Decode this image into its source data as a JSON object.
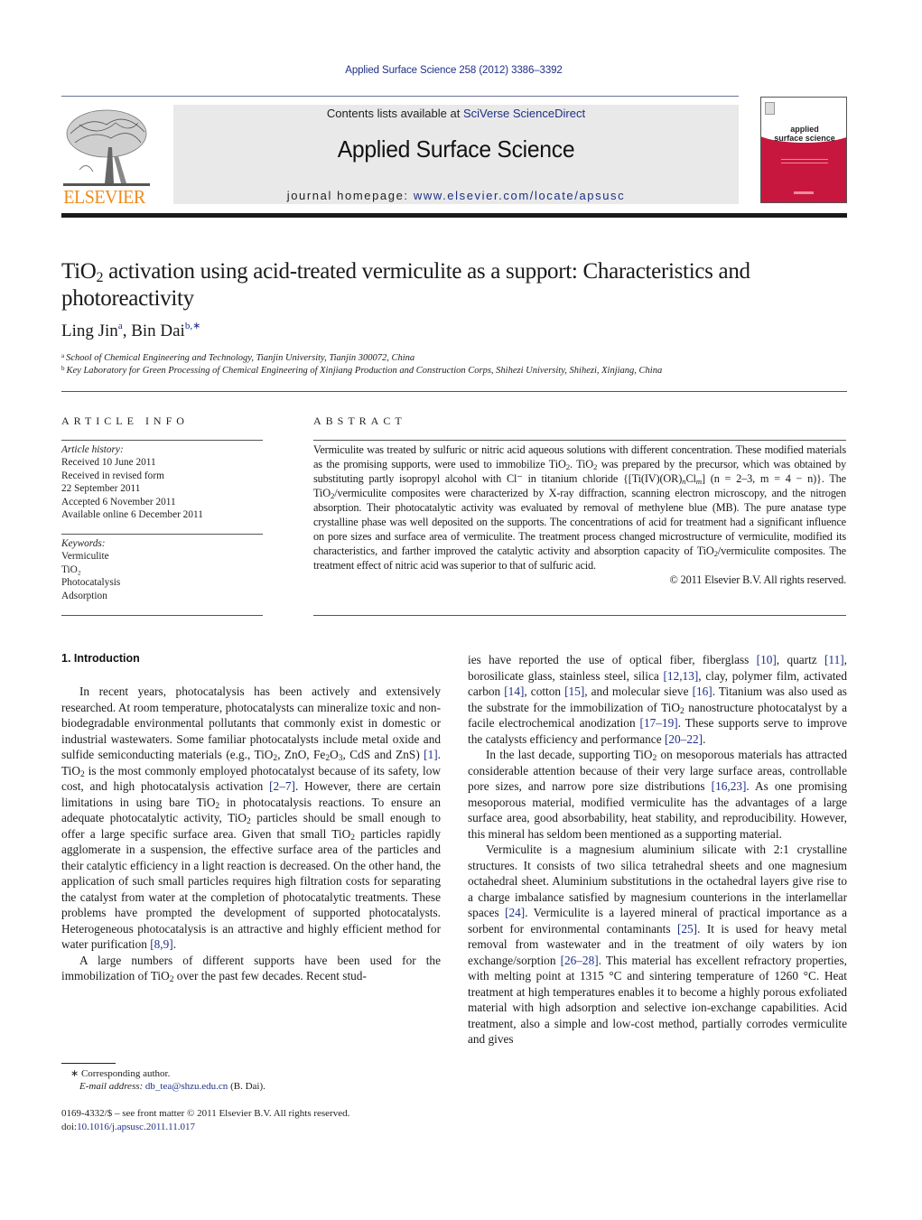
{
  "header": {
    "citation": "Applied Surface Science 258 (2012) 3386–3392",
    "contents_prefix": "Contents lists available at ",
    "contents_link": "SciVerse ScienceDirect",
    "journal_title": "Applied Surface Science",
    "homepage_prefix": "journal homepage: ",
    "homepage_url": "www.elsevier.com/locate/apsusc",
    "publisher_logo_text": "ELSEVIER",
    "cover_title_line1": "applied",
    "cover_title_line2": "surface science",
    "colors": {
      "link": "#1f2f86",
      "elsevier_orange": "#f08a1c",
      "cover_red": "#c8173f",
      "banner_gray": "#e9e9e9"
    }
  },
  "article": {
    "title_pre": "TiO",
    "title_sub": "2",
    "title_post": " activation using acid-treated vermiculite as a support: Characteristics and photoreactivity",
    "authors": [
      {
        "name": "Ling Jin",
        "marks": "a"
      },
      {
        "name": "Bin Dai",
        "marks": "b,∗"
      }
    ],
    "author_sep": ", ",
    "affiliations": [
      {
        "mark": "a",
        "text": "School of Chemical Engineering and Technology, Tianjin University, Tianjin 300072, China"
      },
      {
        "mark": "b",
        "text": "Key Laboratory for Green Processing of Chemical Engineering of Xinjiang Production and Construction Corps, Shihezi University, Shihezi, Xinjiang, China"
      }
    ]
  },
  "article_info": {
    "heading": "ARTICLE INFO",
    "history_label": "Article history:",
    "history": [
      "Received 10 June 2011",
      "Received in revised form",
      "22 September 2011",
      "Accepted 6 November 2011",
      "Available online 6 December 2011"
    ],
    "keywords_label": "Keywords:",
    "keywords": [
      "Vermiculite",
      "TiO₂",
      "Photocatalysis",
      "Adsorption"
    ]
  },
  "abstract": {
    "heading": "ABSTRACT",
    "text_1": "Vermiculite was treated by sulfuric or nitric acid aqueous solutions with different concentration. These modified materials as the promising supports, were used to immobilize TiO",
    "text_2": ". TiO",
    "text_3": " was prepared by the precursor, which was obtained by substituting partly isopropyl alcohol with Cl⁻ in titanium chloride {[Ti(IV)(OR)",
    "text_n": "n",
    "text_cl": "Cl",
    "text_m": "m",
    "text_4": "] (n = 2–3, m = 4 − n)}. The TiO",
    "text_5": "/vermiculite composites were characterized by X-ray diffraction, scanning electron microscopy, and the nitrogen absorption. Their photocatalytic activity was evaluated by removal of methylene blue (MB). The pure anatase type crystalline phase was well deposited on the supports. The concentrations of acid for treatment had a significant influence on pore sizes and surface area of vermiculite. The treatment process changed microstructure of vermiculite, modified its characteristics, and farther improved the catalytic activity and absorption capacity of TiO",
    "text_6": "/vermiculite composites. The treatment effect of nitric acid was superior to that of sulfuric acid.",
    "sub2": "2",
    "copyright": "© 2011 Elsevier B.V. All rights reserved."
  },
  "body": {
    "section_heading": "1.  Introduction",
    "left_p1": [
      "In recent years, photocatalysis has been actively and extensively researched. At room temperature, photocatalysts can mineralize toxic and non-biodegradable environmental pollutants that commonly exist in domestic or industrial wastewaters. Some familiar photocatalysts include metal oxide and sulfide semiconducting materials (e.g., TiO",
      ", ZnO, Fe",
      "O",
      ", CdS and ZnS) ",
      "[1]",
      ". TiO",
      " is the most commonly employed photocatalyst because of its safety, low cost, and high photocatalysis activation ",
      "[2–7]",
      ". However, there are certain limitations in using bare TiO",
      " in photocatalysis reactions. To ensure an adequate photocatalytic activity, TiO",
      " particles should be small enough to offer a large specific surface area. Given that small TiO",
      " particles rapidly agglomerate in a suspension, the effective surface area of the particles and their catalytic efficiency in a light reaction is decreased. On the other hand, the application of such small particles requires high filtration costs for separating the catalyst from water at the completion of photocatalytic treatments. These problems have prompted the development of supported photocatalysts. Heterogeneous photocatalysis is an attractive and highly efficient method for water purification ",
      "[8,9]",
      "."
    ],
    "left_p2": [
      "A large numbers of different supports have been used for the immobilization of TiO",
      " over the past few decades. Recent stud-"
    ],
    "right_p1": [
      "ies have reported the use of optical fiber, fiberglass ",
      "[10]",
      ", quartz ",
      "[11]",
      ", borosilicate glass, stainless steel, silica ",
      "[12,13]",
      ", clay, polymer film, activated carbon ",
      "[14]",
      ", cotton ",
      "[15]",
      ", and molecular sieve ",
      "[16]",
      ". Titanium was also used as the substrate for the immobilization of TiO",
      " nanostructure photocatalyst by a facile electrochemical anodization ",
      "[17–19]",
      ". These supports serve to improve the catalysts efficiency and performance ",
      "[20–22]",
      "."
    ],
    "right_p2": [
      "In the last decade, supporting TiO",
      " on mesoporous materials has attracted considerable attention because of their very large surface areas, controllable pore sizes, and narrow pore size distributions ",
      "[16,23]",
      ". As one promising mesoporous material, modified vermiculite has the advantages of a large surface area, good absorbability, heat stability, and reproducibility. However, this mineral has seldom been mentioned as a supporting material."
    ],
    "right_p3": [
      "Vermiculite is a magnesium aluminium silicate with 2:1 crystalline structures. It consists of two silica tetrahedral sheets and one magnesium octahedral sheet. Aluminium substitutions in the octahedral layers give rise to a charge imbalance satisfied by magnesium counterions in the interlamellar spaces ",
      "[24]",
      ". Vermiculite is a layered mineral of practical importance as a sorbent for environmental contaminants ",
      "[25]",
      ". It is used for heavy metal removal from wastewater and in the treatment of oily waters by ion exchange/sorption ",
      "[26–28]",
      ". This material has excellent refractory properties, with melting point at 1315 °C and sintering temperature of 1260 °C. Heat treatment at high temperatures enables it to become a highly porous exfoliated material with high adsorption and selective ion-exchange capabilities. Acid treatment, also a simple and low-cost method, partially corrodes vermiculite and gives"
    ],
    "sub2": "2",
    "sub3": "3"
  },
  "footnotes": {
    "corresponding_mark": "∗",
    "corresponding_text": "Corresponding author.",
    "email_label": "E-mail address:",
    "email": "db_tea@shzu.edu.cn",
    "email_suffix": " (B. Dai).",
    "issn_line": "0169-4332/$ – see front matter © 2011 Elsevier B.V. All rights reserved.",
    "doi_prefix": "doi:",
    "doi": "10.1016/j.apsusc.2011.11.017"
  }
}
